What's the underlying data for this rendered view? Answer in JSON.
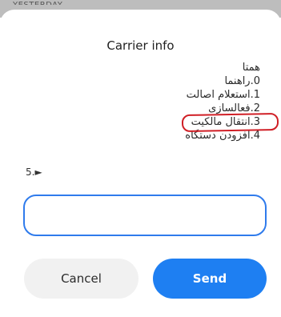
{
  "underlay": {
    "text": "YESTERDAY"
  },
  "dialog": {
    "title": "Carrier info",
    "message_lines": [
      "همتا",
      "0.راهنما",
      "1.استعلام اصالت",
      "2.فعالسازی",
      "3.انتقال مالکیت",
      "4.افزودن دستگاه"
    ],
    "prompt": "5.►",
    "input": {
      "value": "",
      "placeholder": ""
    },
    "buttons": {
      "cancel_label": "Cancel",
      "send_label": "Send"
    }
  },
  "colors": {
    "accent": "#1e7ff2",
    "input_border": "#2f7bec",
    "highlight_ring": "#d01f26",
    "cancel_bg": "#f1f1f1"
  },
  "annotations": {
    "highlighted_item_index": 3
  }
}
